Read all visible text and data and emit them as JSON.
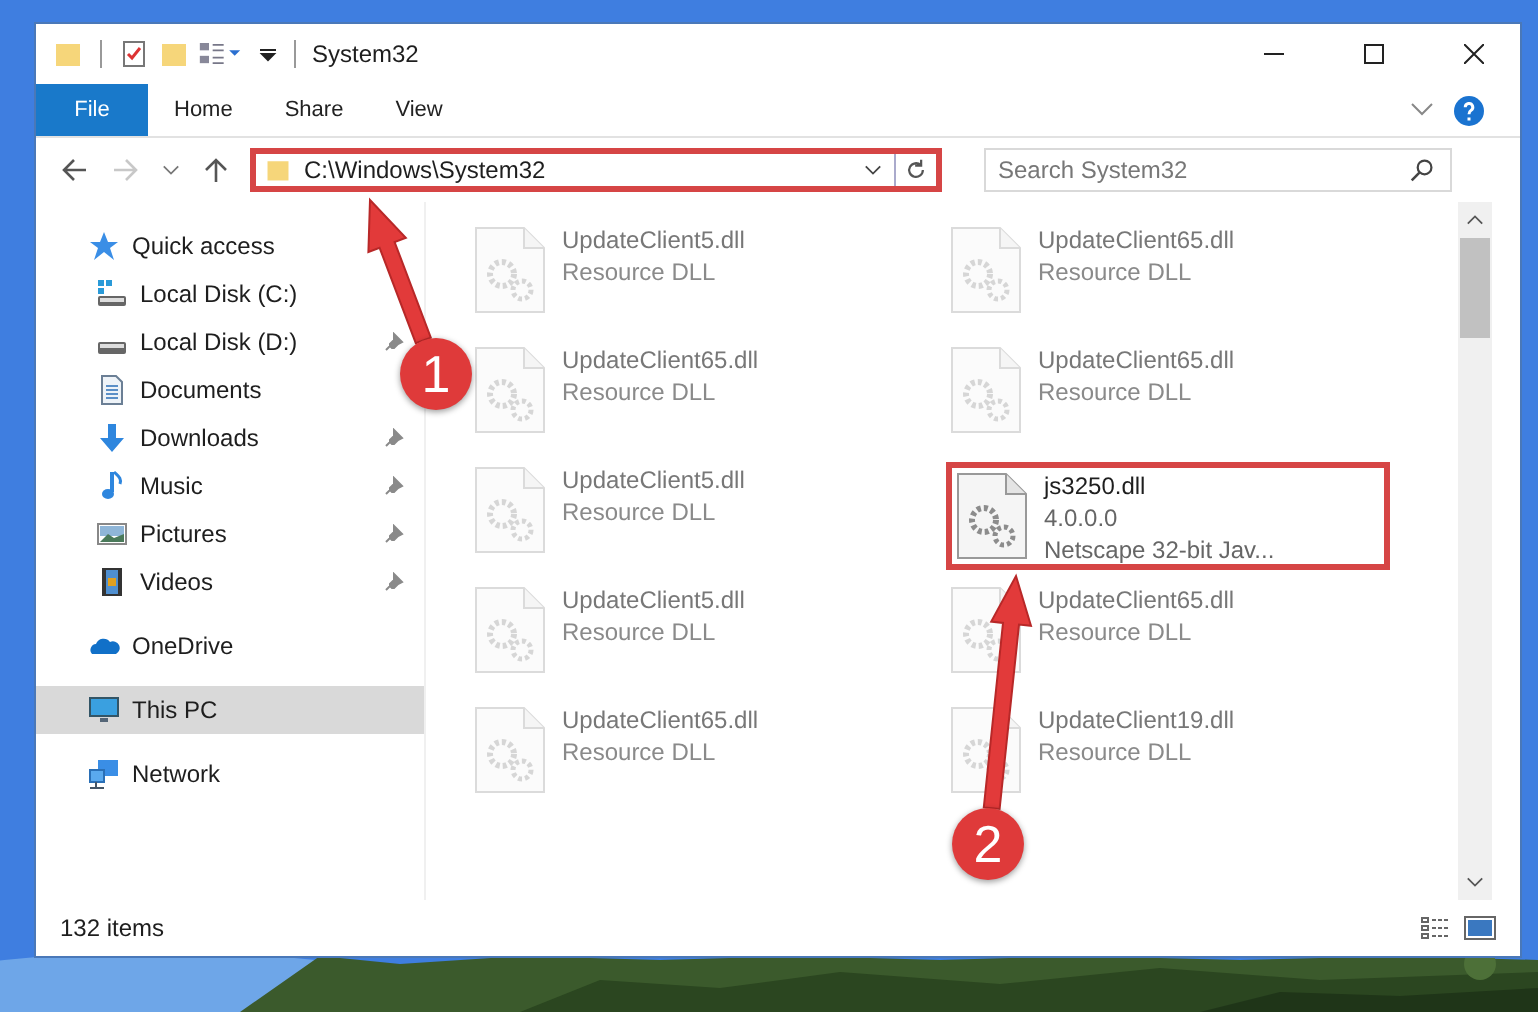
{
  "window": {
    "title": "System32"
  },
  "ribbon_tabs": [
    {
      "label": "File",
      "kind": "menu",
      "selected": false
    },
    {
      "label": "Home",
      "kind": "tab",
      "selected": false
    },
    {
      "label": "Share",
      "kind": "tab",
      "selected": false
    },
    {
      "label": "View",
      "kind": "tab",
      "selected": false
    }
  ],
  "address": {
    "path": "C:\\Windows\\System32",
    "highlighted": true
  },
  "search": {
    "placeholder": "Search System32"
  },
  "nav": [
    {
      "label": "Quick access",
      "kind": "star",
      "selected": false,
      "children": [
        {
          "label": "Local Disk (C:)",
          "kind": "system-drive",
          "pinned": false,
          "selected": false
        },
        {
          "label": "Local Disk (D:)",
          "kind": "drive",
          "pinned": true,
          "selected": false
        },
        {
          "label": "Documents",
          "kind": "documents",
          "pinned": false,
          "selected": false
        },
        {
          "label": "Downloads",
          "kind": "downloads",
          "pinned": true,
          "selected": false
        },
        {
          "label": "Music",
          "kind": "music",
          "pinned": true,
          "selected": false
        },
        {
          "label": "Pictures",
          "kind": "pictures",
          "pinned": true,
          "selected": false
        },
        {
          "label": "Videos",
          "kind": "videos",
          "pinned": true,
          "selected": false
        }
      ]
    },
    {
      "label": "OneDrive",
      "kind": "cloud",
      "selected": false
    },
    {
      "label": "This PC",
      "kind": "pc",
      "selected": true
    },
    {
      "label": "Network",
      "kind": "network",
      "selected": false
    }
  ],
  "files": [
    {
      "name": "UpdateClient5.dll",
      "details": [
        "Resource DLL"
      ],
      "dimmed": true,
      "highlighted": false
    },
    {
      "name": "UpdateClient65.dll",
      "details": [
        "Resource DLL"
      ],
      "dimmed": true,
      "highlighted": false
    },
    {
      "name": "UpdateClient65.dll",
      "details": [
        "Resource DLL"
      ],
      "dimmed": true,
      "highlighted": false
    },
    {
      "name": "UpdateClient65.dll",
      "details": [
        "Resource DLL"
      ],
      "dimmed": true,
      "highlighted": false
    },
    {
      "name": "UpdateClient5.dll",
      "details": [
        "Resource DLL"
      ],
      "dimmed": true,
      "highlighted": false
    },
    {
      "name": "js3250.dll",
      "details": [
        "4.0.0.0",
        "Netscape 32-bit Jav..."
      ],
      "dimmed": false,
      "highlighted": true
    },
    {
      "name": "UpdateClient5.dll",
      "details": [
        "Resource DLL"
      ],
      "dimmed": true,
      "highlighted": false
    },
    {
      "name": "UpdateClient65.dll",
      "details": [
        "Resource DLL"
      ],
      "dimmed": true,
      "highlighted": false
    },
    {
      "name": "UpdateClient65.dll",
      "details": [
        "Resource DLL"
      ],
      "dimmed": true,
      "highlighted": false
    },
    {
      "name": "UpdateClient19.dll",
      "details": [
        "Resource DLL"
      ],
      "dimmed": true,
      "highlighted": false
    }
  ],
  "status_bar": {
    "count": "132 items"
  },
  "annotations": [
    {
      "number": "1"
    },
    {
      "number": "2"
    }
  ]
}
